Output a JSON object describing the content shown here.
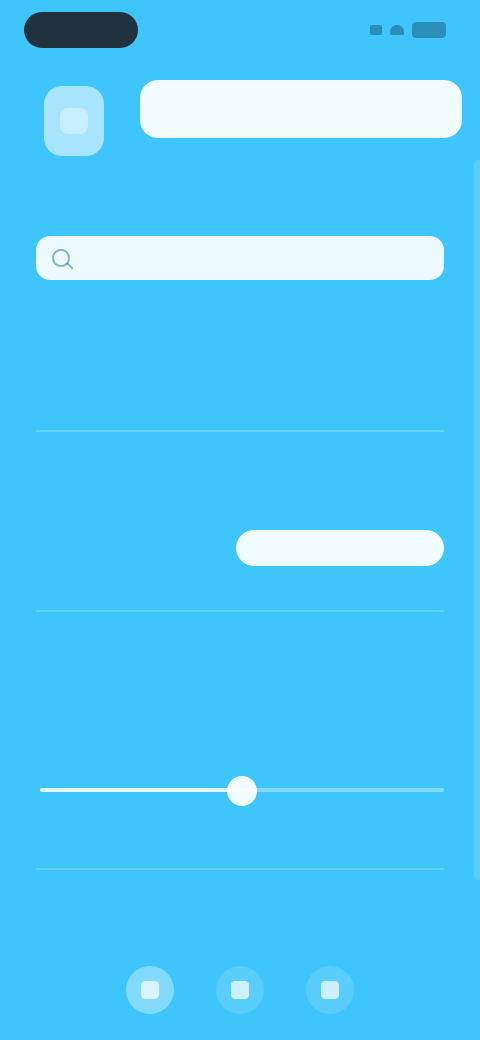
{
  "status_bar": {
    "pill_text": "",
    "icons": [
      "signal-icon",
      "wifi-icon",
      "battery-icon"
    ]
  },
  "header": {
    "app_icon": "app-icon",
    "title": ""
  },
  "search": {
    "value": "",
    "placeholder": ""
  },
  "sections": {
    "s1": "",
    "s2": "",
    "s3": "",
    "s4": "",
    "s5": ""
  },
  "row1": {
    "label": "",
    "button": ""
  },
  "slider": {
    "value_fraction": 0.5,
    "min_label": "",
    "max_label": ""
  },
  "bottom_nav": {
    "items": [
      {
        "icon": "home-icon",
        "active": true
      },
      {
        "icon": "menu-icon",
        "active": false
      },
      {
        "icon": "profile-icon",
        "active": false
      }
    ]
  },
  "colors": {
    "background": "#3EC5FB",
    "accent_text": "#0B5F86"
  }
}
